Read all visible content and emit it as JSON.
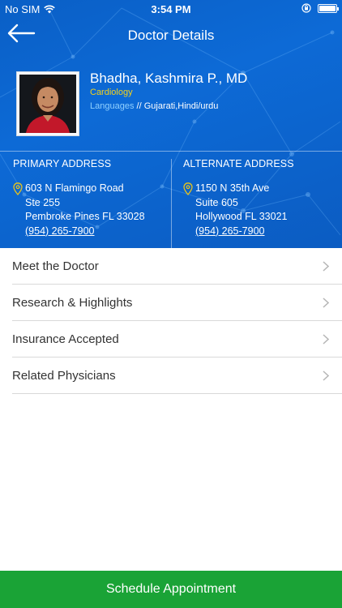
{
  "status_bar": {
    "carrier": "No SIM",
    "time": "3:54 PM"
  },
  "nav": {
    "title": "Doctor Details"
  },
  "doctor": {
    "name": "Bhadha, Kashmira P., MD",
    "specialty": "Cardiology",
    "languages_label": "Languages",
    "languages_separator": "//",
    "languages": "Gujarati,Hindi/urdu"
  },
  "addresses": {
    "primary": {
      "heading": "PRIMARY ADDRESS",
      "line1": "603 N Flamingo Road",
      "line2": "Ste 255",
      "line3": "Pembroke Pines FL 33028",
      "phone": "(954) 265-7900"
    },
    "alternate": {
      "heading": "ALTERNATE ADDRESS",
      "line1": "1150 N 35th Ave",
      "line2": "Suite 605",
      "line3": "Hollywood FL 33021",
      "phone": "(954) 265-7900"
    }
  },
  "menu": [
    {
      "label": "Meet the Doctor"
    },
    {
      "label": "Research & Highlights"
    },
    {
      "label": "Insurance Accepted"
    },
    {
      "label": "Related Physicians"
    }
  ],
  "actions": {
    "schedule_label": "Schedule Appointment"
  },
  "colors": {
    "header_blue": "#0b62cc",
    "specialty_yellow": "#f2d11c",
    "languages_link": "#8fd0ff",
    "schedule_green": "#1aa336",
    "pin_yellow": "#e8c21a"
  },
  "icons": {
    "back": "arrow-left-icon",
    "wifi": "wifi-icon",
    "orientation_lock": "orientation-lock-icon",
    "battery": "battery-icon",
    "location_pin": "location-pin-icon",
    "chevron": "chevron-right-icon"
  }
}
